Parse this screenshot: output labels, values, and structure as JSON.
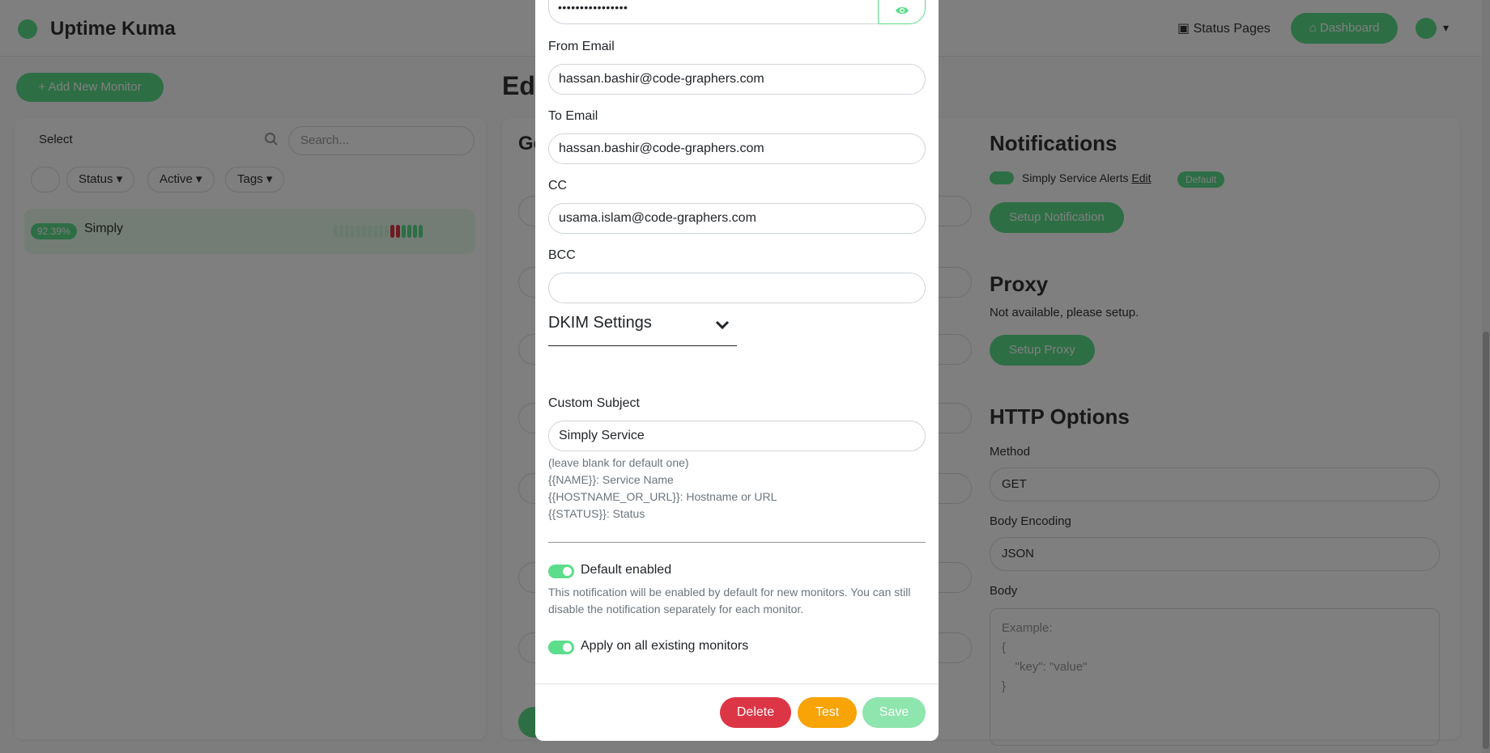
{
  "app": {
    "title": "Uptime Kuma",
    "status_pages_label": "Status Pages",
    "dashboard_label": "Dashboard"
  },
  "sidebar": {
    "add_monitor_label": "Add New Monitor",
    "select_label": "Select",
    "search_placeholder": "Search...",
    "filters": [
      "Status",
      "Active",
      "Tags"
    ],
    "monitors": [
      {
        "uptime": "92.39%",
        "name": "Simply"
      }
    ]
  },
  "edit_page": {
    "heading": "Edit",
    "general_heading": "General",
    "notifications_heading": "Notifications",
    "notification_name": "Simply Service Alerts",
    "notification_edit": "Edit",
    "notification_badge": "Default",
    "setup_notification_label": "Setup Notification",
    "proxy_heading": "Proxy",
    "proxy_note": "Not available, please setup.",
    "setup_proxy_label": "Setup Proxy",
    "http_heading": "HTTP Options",
    "method_label": "Method",
    "method_value": "GET",
    "body_encoding_label": "Body Encoding",
    "body_encoding_value": "JSON",
    "body_label": "Body",
    "body_placeholder": "Example:\n{\n    \"key\": \"value\"\n}"
  },
  "modal": {
    "password_value": "••••••••••••••••",
    "from_email_label": "From Email",
    "from_email_value": "hassan.bashir@code-graphers.com",
    "to_email_label": "To Email",
    "to_email_value": "hassan.bashir@code-graphers.com",
    "cc_label": "CC",
    "cc_value": "usama.islam@code-graphers.com",
    "bcc_label": "BCC",
    "bcc_value": "",
    "dkim_label": "DKIM Settings",
    "custom_subject_label": "Custom Subject",
    "custom_subject_value": "Simply Service",
    "help_lines": [
      "(leave blank for default one)",
      "{{NAME}}: Service Name",
      "{{HOSTNAME_OR_URL}}: Hostname or URL",
      "{{STATUS}}: Status"
    ],
    "default_enabled_label": "Default enabled",
    "default_enabled_help": "This notification will be enabled by default for new monitors. You can still disable the notification separately for each monitor.",
    "apply_existing_label": "Apply on all existing monitors",
    "delete_label": "Delete",
    "test_label": "Test",
    "save_label": "Save"
  },
  "colors": {
    "primary": "#5cdd8b",
    "danger": "#dc3545",
    "warning": "#f8a306",
    "save_disabled": "#8ee5ad"
  },
  "icons": [
    "eye-icon",
    "chevron-down-icon",
    "search-icon",
    "plus-icon",
    "dashboard-icon",
    "status-pages-icon"
  ]
}
